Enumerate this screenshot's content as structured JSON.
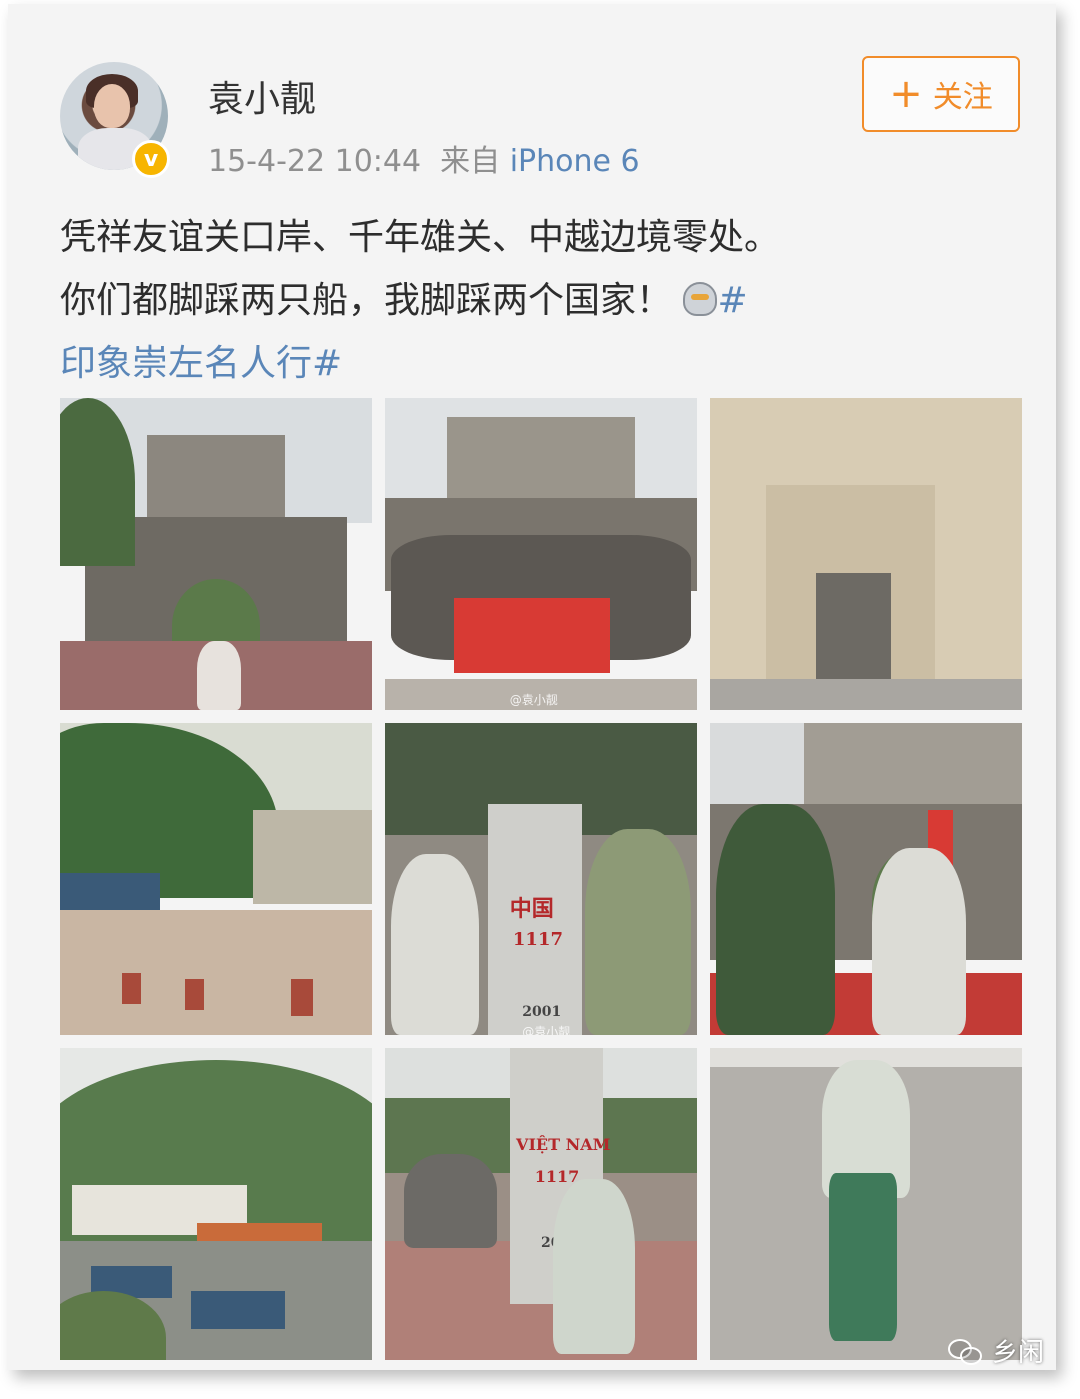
{
  "user": {
    "name": "袁小靓",
    "timestamp": "15-4-22 10:44",
    "source_prefix": "来自",
    "source": "iPhone 6",
    "verified_icon": "verified-badge-icon"
  },
  "follow_button": {
    "plus": "+",
    "label": "关注"
  },
  "post": {
    "line1": "凭祥友谊关口岸、千年雄关、中越边境零处。",
    "line2": "你们都脚踩两只船，我脚踩两个国家！",
    "emoji": "ultraman-emoji-icon",
    "hashtag_start": "#",
    "hashtag_rest": "印象崇左名人行#"
  },
  "photos": {
    "tile2_watermark": "@袁小靓",
    "tile5_label": "中国",
    "tile5_number": "1117",
    "tile5_year": "2001",
    "tile5_watermark": "@袁小靓",
    "tile8_label": "VIỆT NAM",
    "tile8_number": "1117",
    "tile8_year": "200"
  },
  "brand": {
    "label": "乡闲",
    "icon": "wechat-icon"
  },
  "colors": {
    "accent_orange": "#f18c2a",
    "link_blue": "#5a86b8",
    "verified_gold": "#f7b500"
  }
}
